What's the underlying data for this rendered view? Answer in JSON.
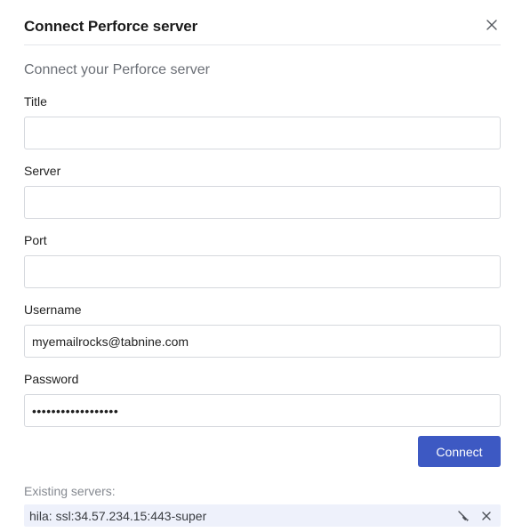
{
  "dialog": {
    "title": "Connect Perforce server",
    "subtitle": "Connect your Perforce server",
    "close_icon": "close-icon"
  },
  "form": {
    "fields": [
      {
        "label": "Title",
        "value": "",
        "placeholder": ""
      },
      {
        "label": "Server",
        "value": "",
        "placeholder": ""
      },
      {
        "label": "Port",
        "value": "",
        "placeholder": ""
      },
      {
        "label": "Username",
        "value": "myemailrocks@tabnine.com",
        "placeholder": ""
      },
      {
        "label": "Password",
        "value": "••••••••••••••••••",
        "placeholder": ""
      }
    ],
    "connect_label": "Connect"
  },
  "existing": {
    "label": "Existing servers:",
    "servers": [
      {
        "name": "hila: ssl:34.57.234.15:443-super",
        "disconnect_icon": "unplug-icon",
        "remove_icon": "close-icon"
      }
    ]
  },
  "colors": {
    "accent": "#3d59c3",
    "row_highlight": "#eef1fb",
    "border": "#d5d8dd"
  }
}
